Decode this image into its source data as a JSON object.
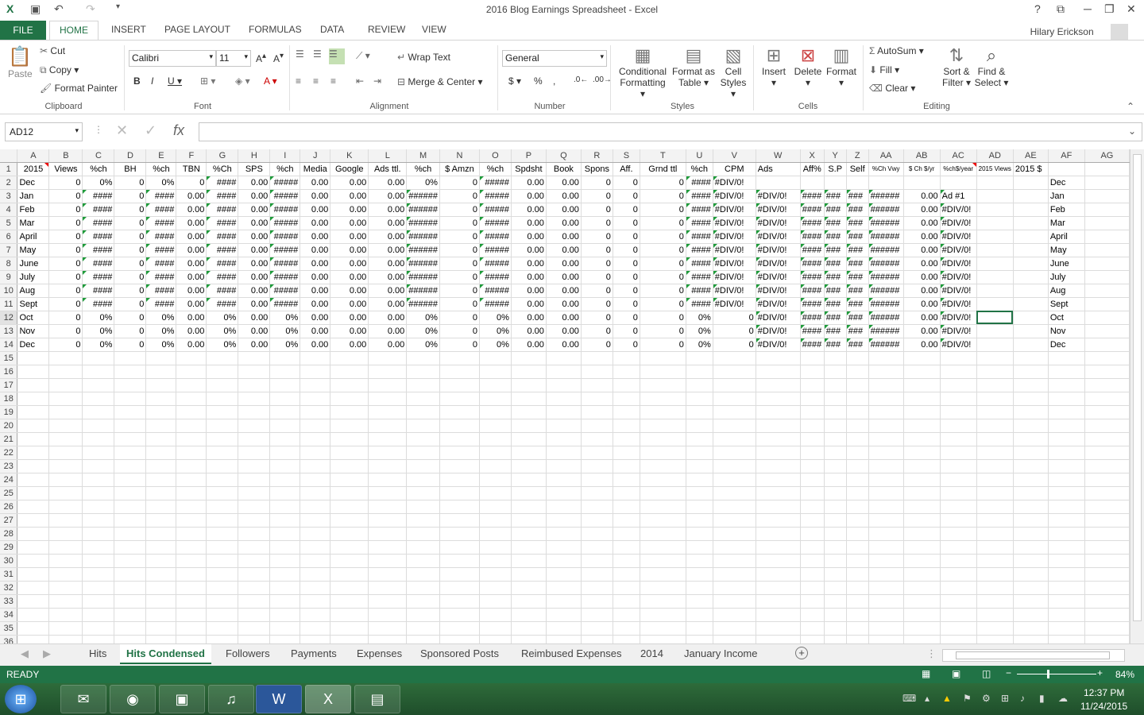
{
  "window": {
    "title": "2016 Blog Earnings Spreadsheet - Excel"
  },
  "ribbon_tabs": [
    "FILE",
    "HOME",
    "INSERT",
    "PAGE LAYOUT",
    "FORMULAS",
    "DATA",
    "REVIEW",
    "VIEW"
  ],
  "user": "Hilary Erickson",
  "clipboard": {
    "paste": "Paste",
    "cut": "Cut",
    "copy": "Copy",
    "format_painter": "Format Painter",
    "label": "Clipboard"
  },
  "font": {
    "name": "Calibri",
    "size": "11",
    "label": "Font"
  },
  "alignment": {
    "wrap": "Wrap Text",
    "merge": "Merge & Center",
    "label": "Alignment"
  },
  "number": {
    "format": "General",
    "label": "Number"
  },
  "styles": {
    "cond": "Conditional",
    "cond2": "Formatting",
    "fat": "Format as",
    "fat2": "Table",
    "cell": "Cell",
    "cell2": "Styles",
    "label": "Styles"
  },
  "cells": {
    "insert": "Insert",
    "delete": "Delete",
    "format": "Format",
    "label": "Cells"
  },
  "editing": {
    "autosum": "AutoSum",
    "fill": "Fill",
    "clear": "Clear",
    "sort": "Sort &",
    "sort2": "Filter",
    "find": "Find &",
    "find2": "Select",
    "label": "Editing"
  },
  "formula_bar": {
    "name_box": "AD12",
    "fx": "fx",
    "value": ""
  },
  "columns": [
    "A",
    "B",
    "C",
    "D",
    "E",
    "F",
    "G",
    "H",
    "I",
    "J",
    "K",
    "L",
    "M",
    "N",
    "O",
    "P",
    "Q",
    "R",
    "S",
    "T",
    "U",
    "V",
    "W",
    "X",
    "Y",
    "Z",
    "AA",
    "AB",
    "AC",
    "AD",
    "AE",
    "AF",
    "AG"
  ],
  "header_row": [
    "2015",
    "Views",
    "%ch",
    "BH",
    "%ch",
    "TBN",
    "%Ch",
    "SPS",
    "%ch",
    "Media",
    "Google",
    "Ads ttl.",
    "%ch",
    "$ Amzn",
    "%ch",
    "Spdsht",
    "Book",
    "Spons",
    "Aff.",
    "Grnd ttl",
    "%ch",
    "CPM",
    "Ads",
    "Aff%",
    "S.P",
    "Self",
    "%Ch Vwy",
    "$ Ch $/yr",
    "%ch$/year",
    "2015 Views",
    "2015 $",
    "",
    ""
  ],
  "months": [
    "Dec",
    "Jan",
    "Feb",
    "Mar",
    "April",
    "May",
    "June",
    "July",
    "Aug",
    "Sept",
    "Oct",
    "Nov",
    "Dec"
  ],
  "values": {
    "zero": "0",
    "dec": "0.00",
    "pct": "0%",
    "hash4": "####",
    "hash5": "#####",
    "hash6": "######",
    "hash3": "###",
    "div": "#DIV/0!",
    "ad1": "Ad #1"
  },
  "sheet_tabs": [
    "Hits",
    "Hits Condensed",
    "Followers",
    "Payments",
    "Expenses",
    "Sponsored Posts",
    "Reimbused Expenses",
    "2014",
    "January Income"
  ],
  "status": {
    "ready": "READY",
    "zoom": "84%"
  },
  "clock": {
    "time": "12:37 PM",
    "date": "11/24/2015"
  }
}
